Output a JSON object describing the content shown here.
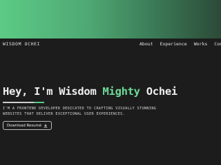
{
  "nav": {
    "brand": "WISDOM OCHEI",
    "links": [
      "About",
      "Experience",
      "Works",
      "Contact"
    ]
  },
  "hero": {
    "greeting": "Hey, I'm Wisdom ",
    "highlight": "Mighty",
    "surname": " Ochei",
    "tagline": "I'M A FRONTEND DEVELOPER DEDICATED TO CRAFTING VISUALLY STUNNING WEBSITES THAT DELIVER EXCEPTIONAL USER EXPERIENCES.",
    "button_label": "Download Resumé"
  },
  "colors": {
    "accent": "#6fdc98",
    "background": "#1c1c1c",
    "banner_start": "#5ccb86",
    "banner_end": "#2c4a38"
  },
  "icons": {
    "download": "download-icon"
  }
}
